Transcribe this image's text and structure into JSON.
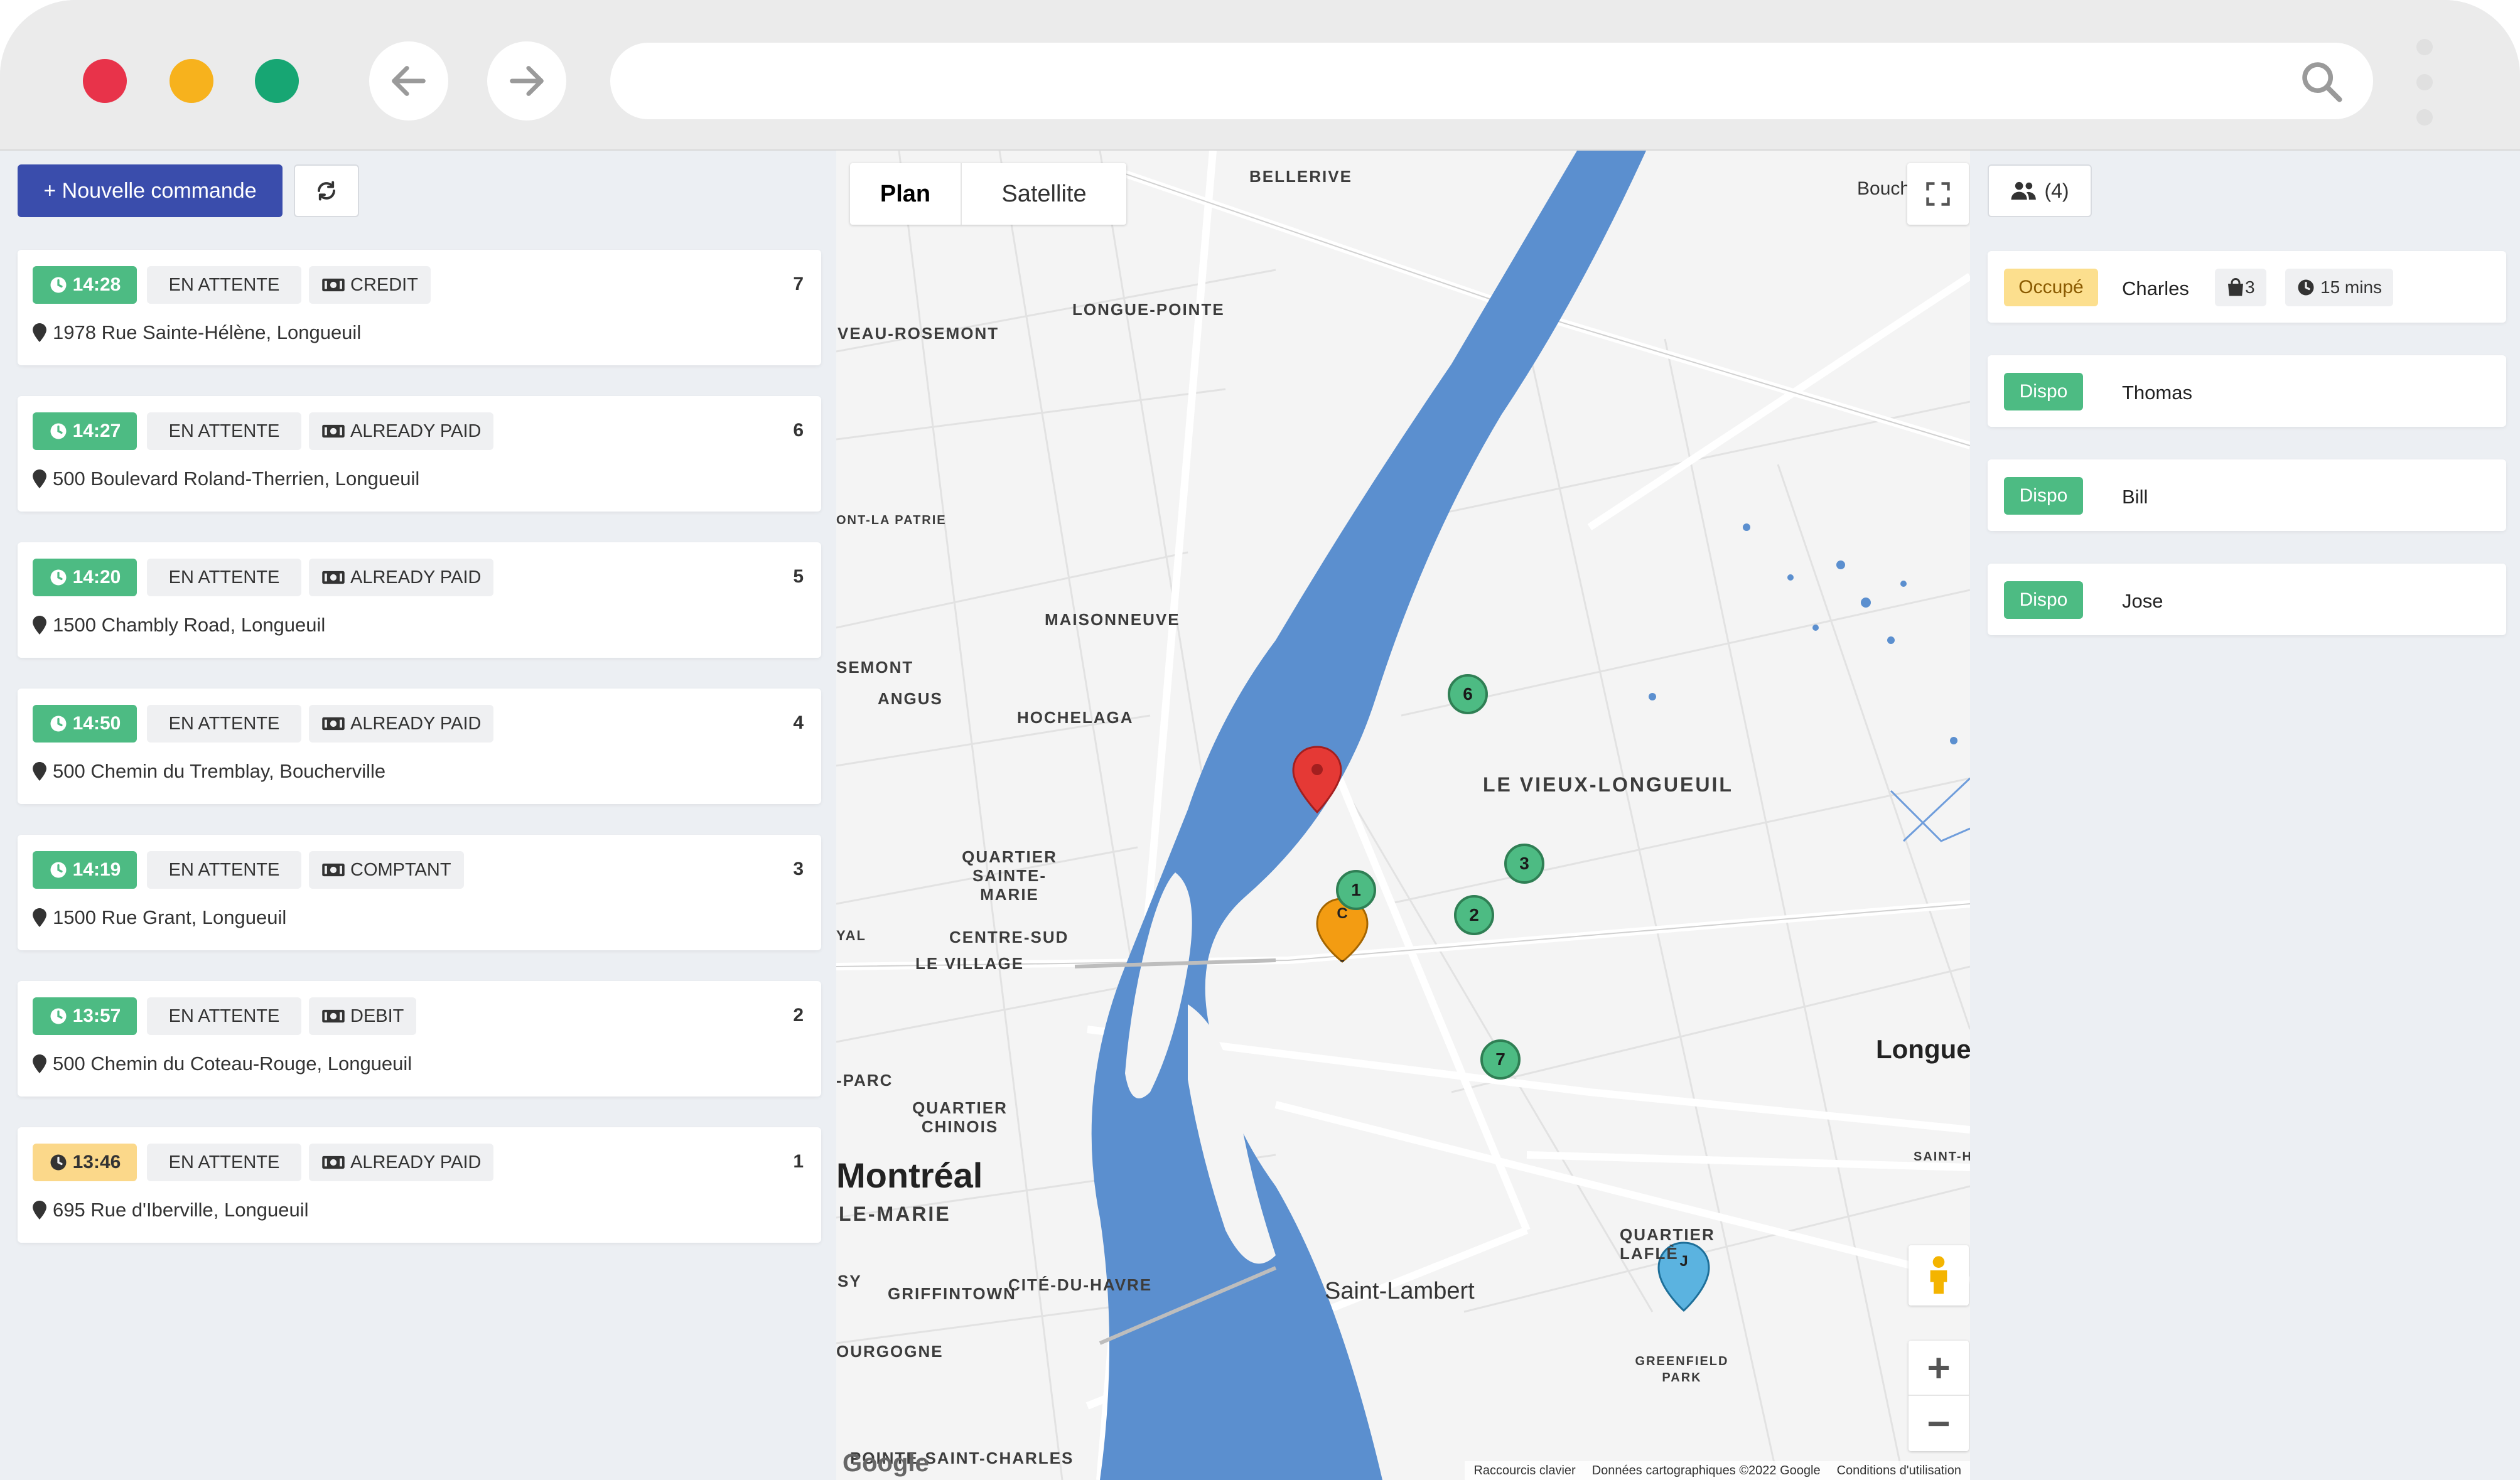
{
  "toolbar": {
    "new_order_label": "+ Nouvelle commande",
    "drivers_count_label": "(4)"
  },
  "orders": [
    {
      "time": "14:28",
      "time_color": "green",
      "status": "EN ATTENTE",
      "payment": "CREDIT",
      "number": "7",
      "address": "1978 Rue Sainte-Hélène, Longueuil"
    },
    {
      "time": "14:27",
      "time_color": "green",
      "status": "EN ATTENTE",
      "payment": "ALREADY PAID",
      "number": "6",
      "address": "500 Boulevard Roland-Therrien, Longueuil"
    },
    {
      "time": "14:20",
      "time_color": "green",
      "status": "EN ATTENTE",
      "payment": "ALREADY PAID",
      "number": "5",
      "address": "1500 Chambly Road, Longueuil"
    },
    {
      "time": "14:50",
      "time_color": "green",
      "status": "EN ATTENTE",
      "payment": "ALREADY PAID",
      "number": "4",
      "address": "500 Chemin du Tremblay, Boucherville"
    },
    {
      "time": "14:19",
      "time_color": "green",
      "status": "EN ATTENTE",
      "payment": "COMPTANT",
      "number": "3",
      "address": "1500 Rue Grant, Longueuil"
    },
    {
      "time": "13:57",
      "time_color": "green",
      "status": "EN ATTENTE",
      "payment": "DEBIT",
      "number": "2",
      "address": "500 Chemin du Coteau-Rouge, Longueuil"
    },
    {
      "time": "13:46",
      "time_color": "yellow",
      "status": "EN ATTENTE",
      "payment": "ALREADY PAID",
      "number": "1",
      "address": "695 Rue d'Iberville, Longueuil"
    }
  ],
  "map": {
    "type_plan": "Plan",
    "type_satellite": "Satellite",
    "labels": {
      "bellerive": "BELLERIVE",
      "longue_pointe": "LONGUE-POINTE",
      "rosemont": "VEAU-ROSEMONT",
      "maisonneuve": "MAISONNEUVE",
      "semont": "SEMONT",
      "angus": "ANGUS",
      "hochelaga": "HOCHELAGA",
      "quartier_ste_marie": "QUARTIER SAINTE-MARIE",
      "centre_sud": "CENTRE-SUD",
      "le_village": "LE VILLAGE",
      "quartier_chinois": "QUARTIER CHINOIS",
      "montreal": "Montréal",
      "le_marie": "LE-MARIE",
      "griffintown": "GRIFFINTOWN",
      "cite_du_havre": "CITÉ-DU-HAVRE",
      "ourgogne": "OURGOGNE",
      "pointe_st_charles": "POINTE-SAINT-CHARLES",
      "saint_lambert": "Saint-Lambert",
      "vieux_longueuil": "LE VIEUX-LONGUEUIL",
      "longueuil": "Longueu",
      "quartier_lafleche": "QUARTIER LAFLÈ",
      "greenfield_park": "GREENFIELD PARK",
      "bouch": "Bouch",
      "parc": "-PARC",
      "yal": "YAL",
      "sy": "SY",
      "ont_la_patrie": "ONT-LA PATRIE",
      "saint_h": "SAINT-H"
    },
    "markers": [
      "1",
      "2",
      "3",
      "6",
      "7"
    ],
    "pins": [
      "C",
      "J"
    ],
    "attribution": [
      "Raccourcis clavier",
      "Données cartographiques ©2022 Google",
      "Conditions d'utilisation"
    ],
    "google": "Google",
    "colors": {
      "water": "#5b8fcf",
      "land": "#f4f4f4",
      "road": "#ffffff",
      "marker": "#4dbb83"
    }
  },
  "drivers": [
    {
      "state": "Occupé",
      "name": "Charles",
      "orders": "3",
      "eta": "15 mins"
    },
    {
      "state": "Dispo",
      "name": "Thomas"
    },
    {
      "state": "Dispo",
      "name": "Bill"
    },
    {
      "state": "Dispo",
      "name": "Jose"
    }
  ],
  "icons": [
    "clock-icon",
    "cash-icon",
    "map-pin-icon",
    "refresh-icon",
    "users-icon",
    "bag-icon",
    "search-icon",
    "fullscreen-icon",
    "pegman-icon"
  ]
}
